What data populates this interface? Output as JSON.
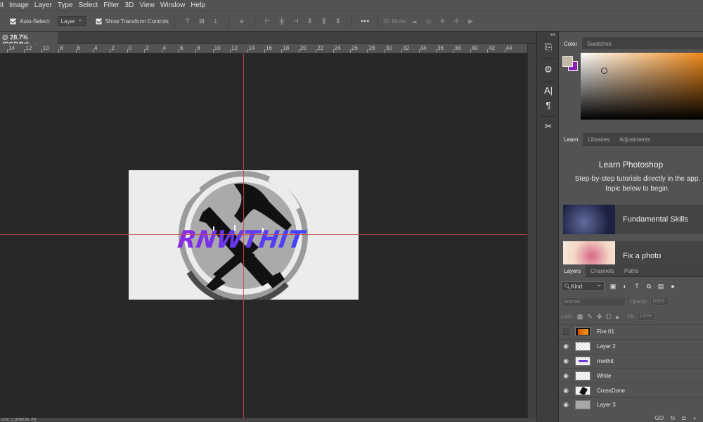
{
  "menu": [
    "it",
    "Image",
    "Layer",
    "Type",
    "Select",
    "Filter",
    "3D",
    "View",
    "Window",
    "Help"
  ],
  "options": {
    "auto_select_label": "Auto-Select:",
    "auto_select_value": "Layer",
    "show_transform_label": "Show Transform Controls",
    "mode_3d_label": "3D Mode:"
  },
  "document": {
    "tab_title": "@ 28.7% (RGB/8#)",
    "close": "×",
    "status": "Doc: 5.93M/38.7M"
  },
  "ruler": [
    "14",
    "12",
    "10",
    "8",
    "6",
    "4",
    "2",
    "0",
    "2",
    "4",
    "6",
    "8",
    "10",
    "12",
    "14",
    "16",
    "18",
    "20",
    "22",
    "24",
    "26",
    "28",
    "30",
    "32",
    "34",
    "36",
    "38",
    "40",
    "42",
    "44"
  ],
  "artwork": {
    "logo_text": "RNWTHIT"
  },
  "color_panel": {
    "tabs": [
      "Color",
      "Swatches"
    ],
    "foreground": "#c6b8a8",
    "background": "#8a1fb5",
    "hue": "#f08a1a"
  },
  "learn_panel": {
    "tabs": [
      "Learn",
      "Libraries",
      "Adjustments"
    ],
    "title": "Learn Photoshop",
    "subtitle": "Step-by-step tutorials directly in the app. topic below to begin.",
    "cards": [
      {
        "label": "Fundamental Skills"
      },
      {
        "label": "Fix a photo"
      }
    ]
  },
  "layers_panel": {
    "tabs": [
      "Layers",
      "Channels",
      "Paths"
    ],
    "filter_kind": "Kind",
    "blend_mode": "Normal",
    "opacity_label": "Opacity:",
    "opacity_value": "100%",
    "lock_label": "Lock:",
    "fill_label": "Fill:",
    "fill_value": "100%",
    "layers": [
      {
        "name": "Fire 01",
        "visible": false
      },
      {
        "name": "Layer 2",
        "visible": true
      },
      {
        "name": "rnwthit",
        "visible": true
      },
      {
        "name": "White",
        "visible": true
      },
      {
        "name": "CrossDone",
        "visible": true
      },
      {
        "name": "Layer 3",
        "visible": true
      }
    ],
    "footer": [
      "GO",
      "fx"
    ]
  }
}
